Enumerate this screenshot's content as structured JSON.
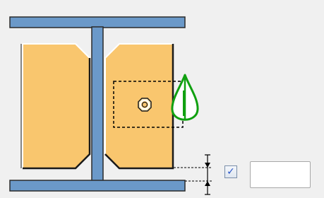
{
  "diagram": {
    "colors": {
      "beam": "#6b99c9",
      "beam_outline": "#2a2a2a",
      "plate": "#f9c66e",
      "plate_outline": "#1a1a1a",
      "plate_highlight": "#ffffff",
      "selection_box": "#000000",
      "anchor_symbol": "#10a010",
      "background": "#f0f0f0"
    },
    "icons": {
      "bolt": "bolt-icon",
      "anchor": "anchor-point-icon",
      "dimension": "dimension-arrows-icon"
    }
  },
  "offset_control": {
    "checked": true,
    "check_glyph": "✓",
    "value": ""
  }
}
